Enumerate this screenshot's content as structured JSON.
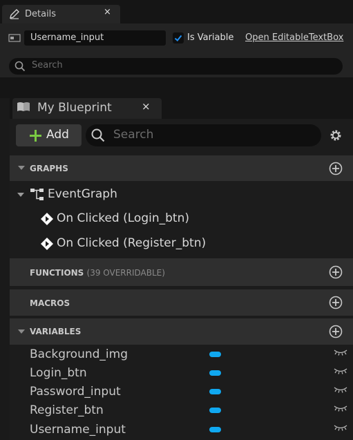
{
  "details_panel": {
    "tab_title": "Details",
    "close_glyph": "×",
    "name_value": "Username_input",
    "is_variable_label": "Is Variable",
    "is_variable_checked": true,
    "open_link": "Open EditableTextBox",
    "search_placeholder": "Search"
  },
  "blueprint_panel": {
    "tab_title": "My Blueprint",
    "close_glyph": "×",
    "add_label": "Add",
    "search_placeholder": "Search",
    "sections": {
      "graphs": {
        "label": "GRAPHS",
        "event_graph": "EventGraph",
        "events": [
          "On Clicked (Login_btn)",
          "On Clicked (Register_btn)"
        ]
      },
      "functions": {
        "label": "FUNCTIONS",
        "sublabel": "(39 OVERRIDABLE)"
      },
      "macros": {
        "label": "MACROS"
      },
      "variables": {
        "label": "VARIABLES",
        "items": [
          "Background_img",
          "Login_btn",
          "Password_input",
          "Register_btn",
          "Username_input"
        ]
      }
    }
  },
  "colors": {
    "variable_type_pill": "#10a8f0",
    "add_plus": "#7ac943",
    "checkbox_check": "#1e8ef0"
  },
  "icons": [
    "pencil-icon",
    "widget-icon",
    "search-icon",
    "book-icon",
    "plus-icon",
    "gear-icon",
    "caret-down-icon",
    "graph-icon",
    "event-diamond-icon",
    "add-circle-icon",
    "eye-closed-icon",
    "checkmark-icon"
  ]
}
